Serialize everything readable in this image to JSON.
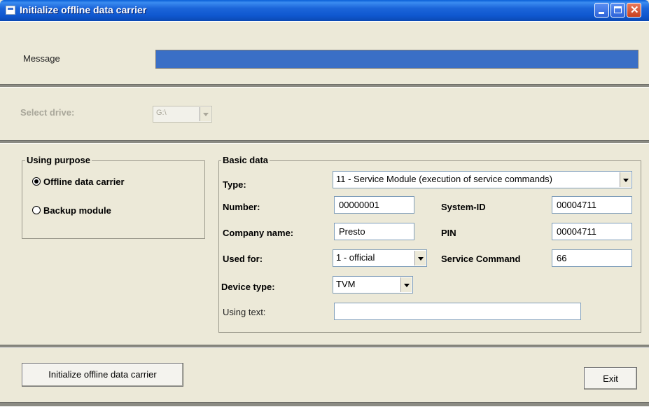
{
  "window": {
    "title": "Initialize offline data carrier"
  },
  "message": {
    "label": "Message"
  },
  "drive": {
    "label": "Select drive:",
    "value": "G:\\"
  },
  "purpose": {
    "title": "Using purpose",
    "options": [
      {
        "label": "Offline data carrier",
        "selected": true
      },
      {
        "label": "Backup module",
        "selected": false
      }
    ]
  },
  "basic": {
    "title": "Basic data",
    "type_label": "Type:",
    "type_value": "11 - Service Module (execution of service commands)",
    "number_label": "Number:",
    "number_value": "00000001",
    "system_id_label": "System-ID",
    "system_id_value": "00004711",
    "company_label": "Company name:",
    "company_value": "Presto",
    "pin_label": "PIN",
    "pin_value": "00004711",
    "used_for_label": "Used for:",
    "used_for_value": "1 - official",
    "service_command_label": "Service Command",
    "service_command_value": "66",
    "device_type_label": "Device type:",
    "device_type_value": "TVM",
    "using_text_label": "Using text:",
    "using_text_value": ""
  },
  "footer": {
    "initialize_label": "Initialize offline data carrier",
    "exit_label": "Exit"
  }
}
